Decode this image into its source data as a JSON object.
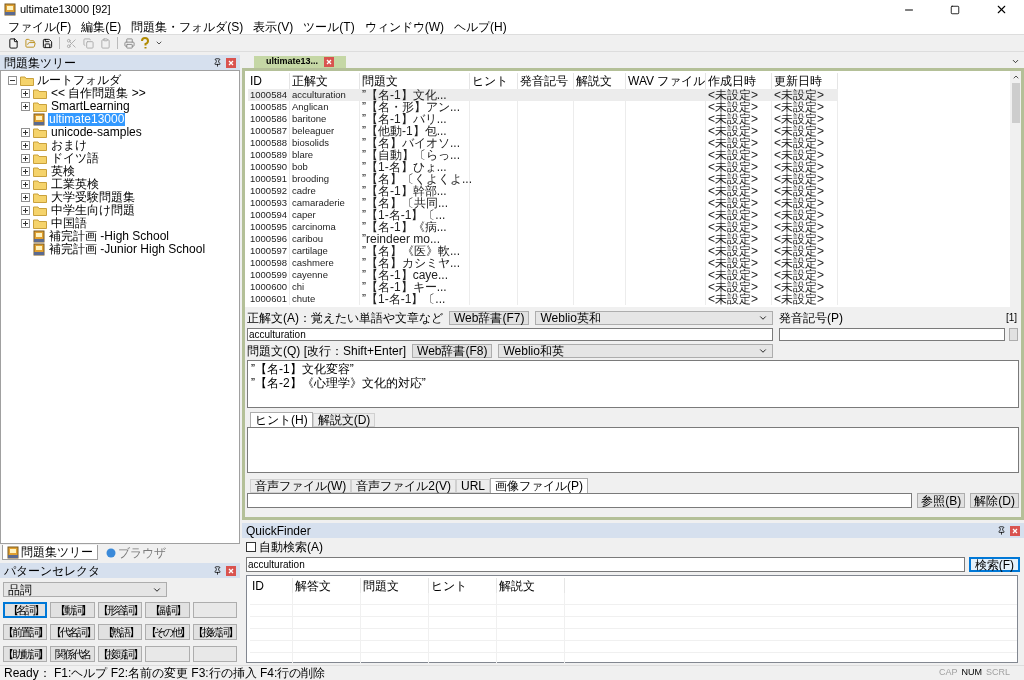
{
  "window": {
    "title": "ultimate13000 [92]"
  },
  "menu": [
    "ファイル(F)",
    "編集(E)",
    "問題集・フォルダ(S)",
    "表示(V)",
    "ツール(T)",
    "ウィンドウ(W)",
    "ヘルプ(H)"
  ],
  "tree_panel": {
    "title": "問題集ツリー",
    "root": {
      "label": "ルートフォルダ",
      "expanded": true,
      "children": [
        {
          "label": "<< 自作問題集 >>",
          "kind": "folder",
          "expanded": false,
          "selected": false
        },
        {
          "label": "SmartLearning",
          "kind": "folder",
          "expanded": false,
          "selected": false
        },
        {
          "label": "ultimate13000",
          "kind": "book",
          "selected": true
        },
        {
          "label": "unicode-samples",
          "kind": "folder",
          "expanded": false,
          "selected": false
        },
        {
          "label": "おまけ",
          "kind": "folder",
          "expanded": false,
          "selected": false
        },
        {
          "label": "ドイツ語",
          "kind": "folder",
          "expanded": false,
          "selected": false
        },
        {
          "label": "英検",
          "kind": "folder",
          "expanded": false,
          "selected": false
        },
        {
          "label": "工業英検",
          "kind": "folder",
          "expanded": false,
          "selected": false
        },
        {
          "label": "大学受験問題集",
          "kind": "folder",
          "expanded": false,
          "selected": false
        },
        {
          "label": "中学生向け問題",
          "kind": "folder",
          "expanded": false,
          "selected": false
        },
        {
          "label": "中国語",
          "kind": "folder",
          "expanded": false,
          "selected": false
        },
        {
          "label": "補完計画 -High School",
          "kind": "book",
          "selected": false
        },
        {
          "label": "補完計画 -Junior High School",
          "kind": "book",
          "selected": false
        }
      ]
    }
  },
  "left_tabs": [
    {
      "label": "問題集ツリー",
      "selected": true
    },
    {
      "label": "ブラウザ",
      "selected": false
    }
  ],
  "pattern_selector": {
    "title": "パターンセレクタ",
    "dropdown": "品詞",
    "buttons": [
      {
        "kind": "word",
        "label": "【名詞】",
        "selected": true
      },
      {
        "kind": "word",
        "label": "【動詞】",
        "selected": false
      },
      {
        "kind": "word",
        "label": "【形容詞】",
        "selected": false
      },
      {
        "kind": "word",
        "label": "【副詞】",
        "selected": false
      },
      {
        "kind": "blank",
        "selected": false
      },
      {
        "kind": "word",
        "label": "【前置詞】",
        "selected": false
      },
      {
        "kind": "word",
        "label": "【代名詞】",
        "selected": false
      },
      {
        "kind": "word",
        "label": "【熟語】",
        "selected": false
      },
      {
        "kind": "word",
        "label": "【その他】",
        "selected": false
      },
      {
        "kind": "word",
        "label": "【接続詞】",
        "selected": false
      },
      {
        "kind": "word",
        "label": "【助動詞】",
        "selected": false
      },
      {
        "kind": "word",
        "label": "関係代名",
        "selected": false
      },
      {
        "kind": "word",
        "label": "【接頭詞】",
        "selected": false
      },
      {
        "kind": "blank",
        "selected": false
      },
      {
        "kind": "blank",
        "selected": false
      }
    ]
  },
  "document_tab": {
    "label": "ultimate13..."
  },
  "table": {
    "columns": [
      "ID",
      "正解文",
      "問題文",
      "ヒント",
      "発音記号",
      "解説文",
      "WAV ファイル",
      "作成日時",
      "更新日時"
    ],
    "rows": [
      {
        "id": "1000584",
        "answer": "acculturation",
        "question": "”【名-1】文化...",
        "created": "<未設定>",
        "updated": "<未設定>",
        "selected": true
      },
      {
        "id": "1000585",
        "answer": "Anglican",
        "question": "”【名・形】アン...",
        "created": "<未設定>",
        "updated": "<未設定>",
        "selected": false
      },
      {
        "id": "1000586",
        "answer": "baritone",
        "question": "”【名-1】バリ...",
        "created": "<未設定>",
        "updated": "<未設定>",
        "selected": false
      },
      {
        "id": "1000587",
        "answer": "beleaguer",
        "question": "”【他動-1】包...",
        "created": "<未設定>",
        "updated": "<未設定>",
        "selected": false
      },
      {
        "id": "1000588",
        "answer": "biosolids",
        "question": "”【名】バイオソ...",
        "created": "<未設定>",
        "updated": "<未設定>",
        "selected": false
      },
      {
        "id": "1000589",
        "answer": "blare",
        "question": "”【自動】〔らっ...",
        "created": "<未設定>",
        "updated": "<未設定>",
        "selected": false
      },
      {
        "id": "1000590",
        "answer": "bob",
        "question": "”【1-名】ひょ...",
        "created": "<未設定>",
        "updated": "<未設定>",
        "selected": false
      },
      {
        "id": "1000591",
        "answer": "brooding",
        "question": "”【名】〔くよくよ...",
        "created": "<未設定>",
        "updated": "<未設定>",
        "selected": false
      },
      {
        "id": "1000592",
        "answer": "cadre",
        "question": "”【名-1】幹部...",
        "created": "<未設定>",
        "updated": "<未設定>",
        "selected": false
      },
      {
        "id": "1000593",
        "answer": "camaraderie",
        "question": "”【名】〔共同...",
        "created": "<未設定>",
        "updated": "<未設定>",
        "selected": false
      },
      {
        "id": "1000594",
        "answer": "caper",
        "question": "”【1-名-1】〔...",
        "created": "<未設定>",
        "updated": "<未設定>",
        "selected": false
      },
      {
        "id": "1000595",
        "answer": "carcinoma",
        "question": "”【名-1】《病...",
        "created": "<未設定>",
        "updated": "<未設定>",
        "selected": false
      },
      {
        "id": "1000596",
        "answer": "caribou",
        "question": "”reindeer mo...",
        "created": "<未設定>",
        "updated": "<未設定>",
        "selected": false
      },
      {
        "id": "1000597",
        "answer": "cartilage",
        "question": "”【名】《医》軟...",
        "created": "<未設定>",
        "updated": "<未設定>",
        "selected": false
      },
      {
        "id": "1000598",
        "answer": "cashmere",
        "question": "”【名】カシミヤ...",
        "created": "<未設定>",
        "updated": "<未設定>",
        "selected": false
      },
      {
        "id": "1000599",
        "answer": "cayenne",
        "question": "”【名-1】caye...",
        "created": "<未設定>",
        "updated": "<未設定>",
        "selected": false
      },
      {
        "id": "1000600",
        "answer": "chi",
        "question": "”【名-1】キー...",
        "created": "<未設定>",
        "updated": "<未設定>",
        "selected": false
      },
      {
        "id": "1000601",
        "answer": "chute",
        "question": "”【1-名-1】〔...",
        "created": "<未設定>",
        "updated": "<未設定>",
        "selected": false
      }
    ]
  },
  "editor": {
    "answer_label": "正解文(A)：覚えたい単語や文章など",
    "answer_web_button": "Web辞書(F7)",
    "answer_dictionary": "Weblio英和",
    "pronunciation_label": "発音記号(P)",
    "counter": "[1]",
    "answer_value": "acculturation",
    "question_label": "問題文(Q) [改行：Shift+Enter]",
    "question_web_button": "Web辞書(F8)",
    "question_dictionary": "Weblio和英",
    "question_lines": [
      "”【名-1】文化変容”",
      "”【名-2】《心理学》文化的対応”"
    ],
    "note_tabs": [
      {
        "label": "ヒント(H)",
        "selected": true
      },
      {
        "label": "解説文(D)",
        "selected": false
      }
    ],
    "file_tabs": [
      {
        "label": "音声ファイル(W)",
        "selected": false
      },
      {
        "label": "音声ファイル2(V)",
        "selected": false
      },
      {
        "label": "URL",
        "selected": false
      },
      {
        "label": "画像ファイル(P)",
        "selected": true
      }
    ],
    "browse_button": "参照(B)",
    "clear_button": "解除(D)"
  },
  "quickfinder": {
    "title": "QuickFinder",
    "auto_search": {
      "label": "自動検索(A)",
      "checked": false
    },
    "search_value": "acculturation",
    "search_button": "検索(F)",
    "columns": [
      "ID",
      "解答文",
      "問題文",
      "ヒント",
      "解説文"
    ]
  },
  "status_bar": {
    "text": "Ready： F1:ヘルプ F2:名前の変更 F3:行の挿入 F4:行の削除",
    "indicators": [
      {
        "label": "CAP",
        "on": false
      },
      {
        "label": "NUM",
        "on": true
      },
      {
        "label": "SCRL",
        "on": false
      }
    ]
  }
}
